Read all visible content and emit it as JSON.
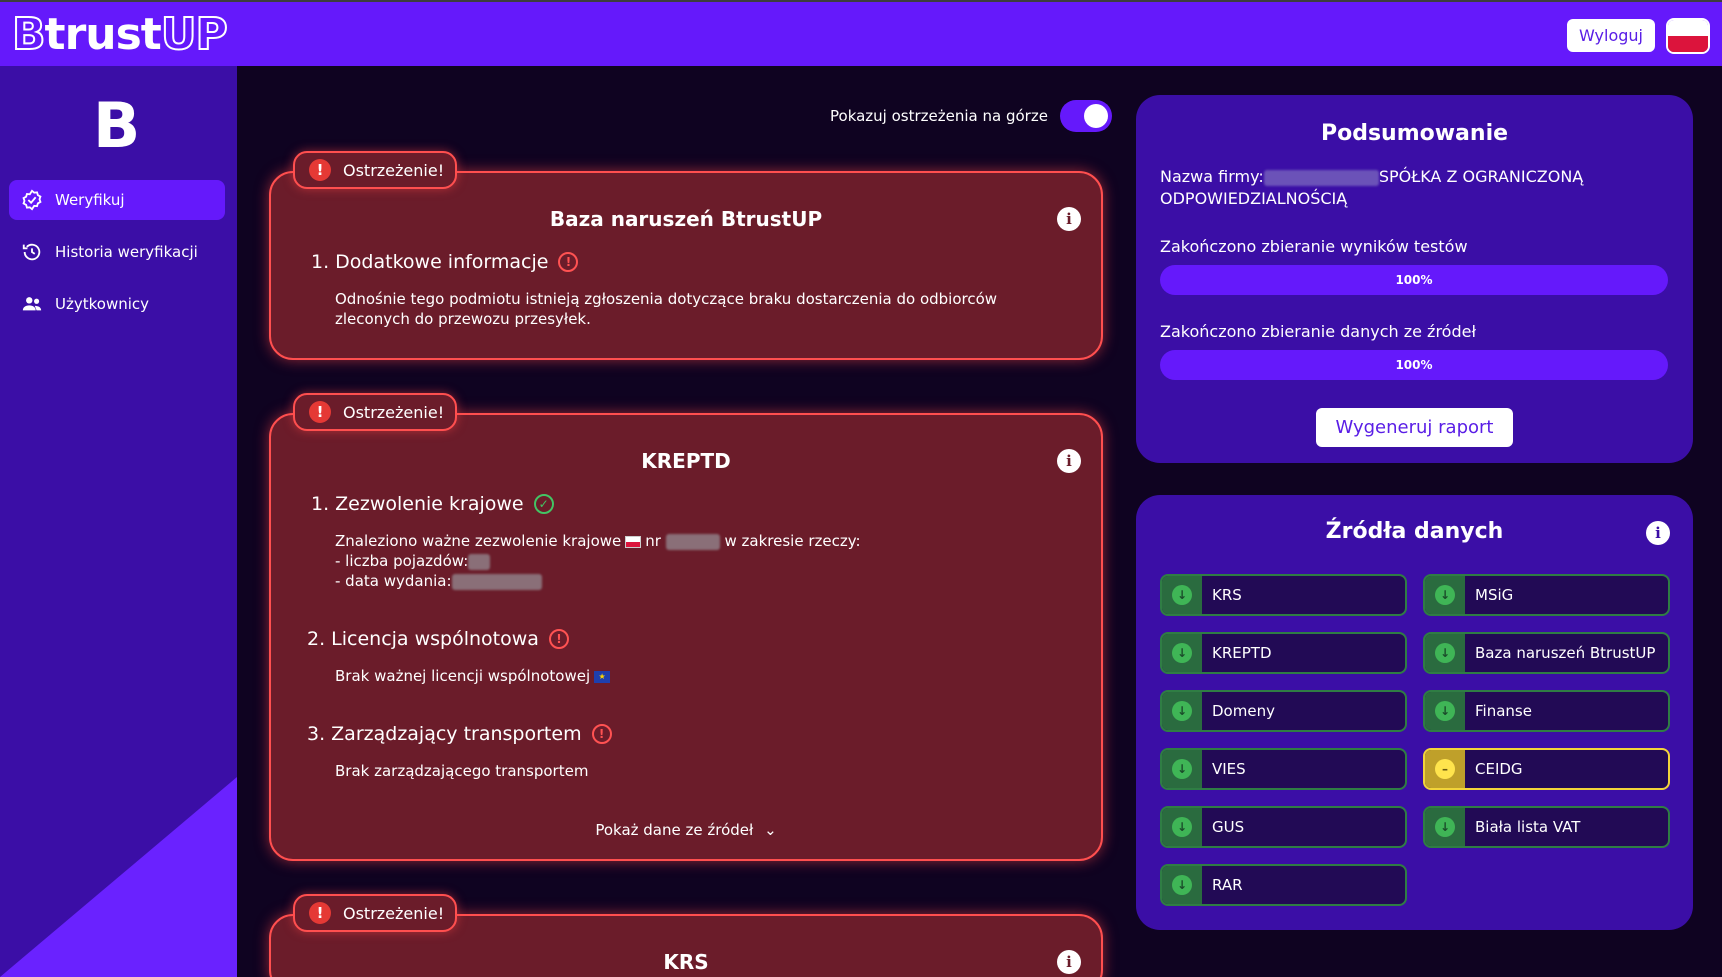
{
  "app": {
    "logo_prefix": "B",
    "logo_mid": "trust",
    "logo_suffix": "UP",
    "side_logo": "B",
    "logout_label": "Wyloguj"
  },
  "sidebar": {
    "items": [
      {
        "label": "Weryfikuj",
        "icon": "verify-icon",
        "active": true
      },
      {
        "label": "Historia weryfikacji",
        "icon": "history-icon",
        "active": false
      },
      {
        "label": "Użytkownicy",
        "icon": "users-icon",
        "active": false
      }
    ]
  },
  "toggle": {
    "label": "Pokazuj ostrzeżenia na górze",
    "on": true
  },
  "warning_label": "Ostrzeżenie!",
  "cards": [
    {
      "title": "Baza naruszeń BtrustUP",
      "sections": [
        {
          "heading": "1. Dodatkowe informacje",
          "status": "bad",
          "text": "Odnośnie tego podmiotu istnieją zgłoszenia dotyczące braku dostarczenia do odbiorców zleconych do przewozu przesyłek."
        }
      ]
    },
    {
      "title": "KREPTD",
      "sections": [
        {
          "heading": "1. Zezwolenie krajowe",
          "status": "ok",
          "line1_a": "Znaleziono ważne zezwolenie krajowe",
          "line1_b": "nr",
          "line1_c": "w zakresie rzeczy:",
          "line2": "- liczba pojazdów:",
          "line3": "- data wydania:"
        },
        {
          "heading": "2. Licencja wspólnotowa",
          "status": "bad",
          "text": "Brak ważnej licencji wspólnotowej"
        },
        {
          "heading": "3. Zarządzający transportem",
          "status": "bad",
          "text": "Brak zarządzającego transportem"
        }
      ],
      "show_sources": "Pokaż dane ze źródeł"
    },
    {
      "title": "KRS"
    }
  ],
  "summary": {
    "title": "Podsumowanie",
    "company_label": "Nazwa firmy:",
    "company_suffix": "SPÓŁKA Z OGRANICZONĄ",
    "company_line2": "ODPOWIEDZIALNOŚCIĄ",
    "tests_label": "Zakończono zbieranie wyników testów",
    "tests_progress": "100%",
    "tests_fraction": 1.0,
    "sources_label": "Zakończono zbieranie danych ze źródeł",
    "sources_progress": "100%",
    "sources_fraction": 1.0,
    "generate_label": "Wygeneruj raport"
  },
  "data_sources": {
    "title": "Źródła danych",
    "items": [
      {
        "label": "KRS",
        "status": "ok"
      },
      {
        "label": "MSiG",
        "status": "ok"
      },
      {
        "label": "KREPTD",
        "status": "ok"
      },
      {
        "label": "Baza naruszeń BtrustUP",
        "status": "ok"
      },
      {
        "label": "Domeny",
        "status": "ok"
      },
      {
        "label": "Finanse",
        "status": "ok"
      },
      {
        "label": "VIES",
        "status": "ok"
      },
      {
        "label": "CEIDG",
        "status": "warning"
      },
      {
        "label": "GUS",
        "status": "ok"
      },
      {
        "label": "Biała lista VAT",
        "status": "ok"
      },
      {
        "label": "RAR",
        "status": "ok"
      }
    ]
  },
  "colors": {
    "accent": "#6519fb",
    "sidebar": "#3b0ea6",
    "background": "#0f0321",
    "warning_card": "#6b1c2a",
    "warning_border": "#ff4f4f",
    "ok": "#3fb556",
    "warn_source": "#ffe44d"
  }
}
